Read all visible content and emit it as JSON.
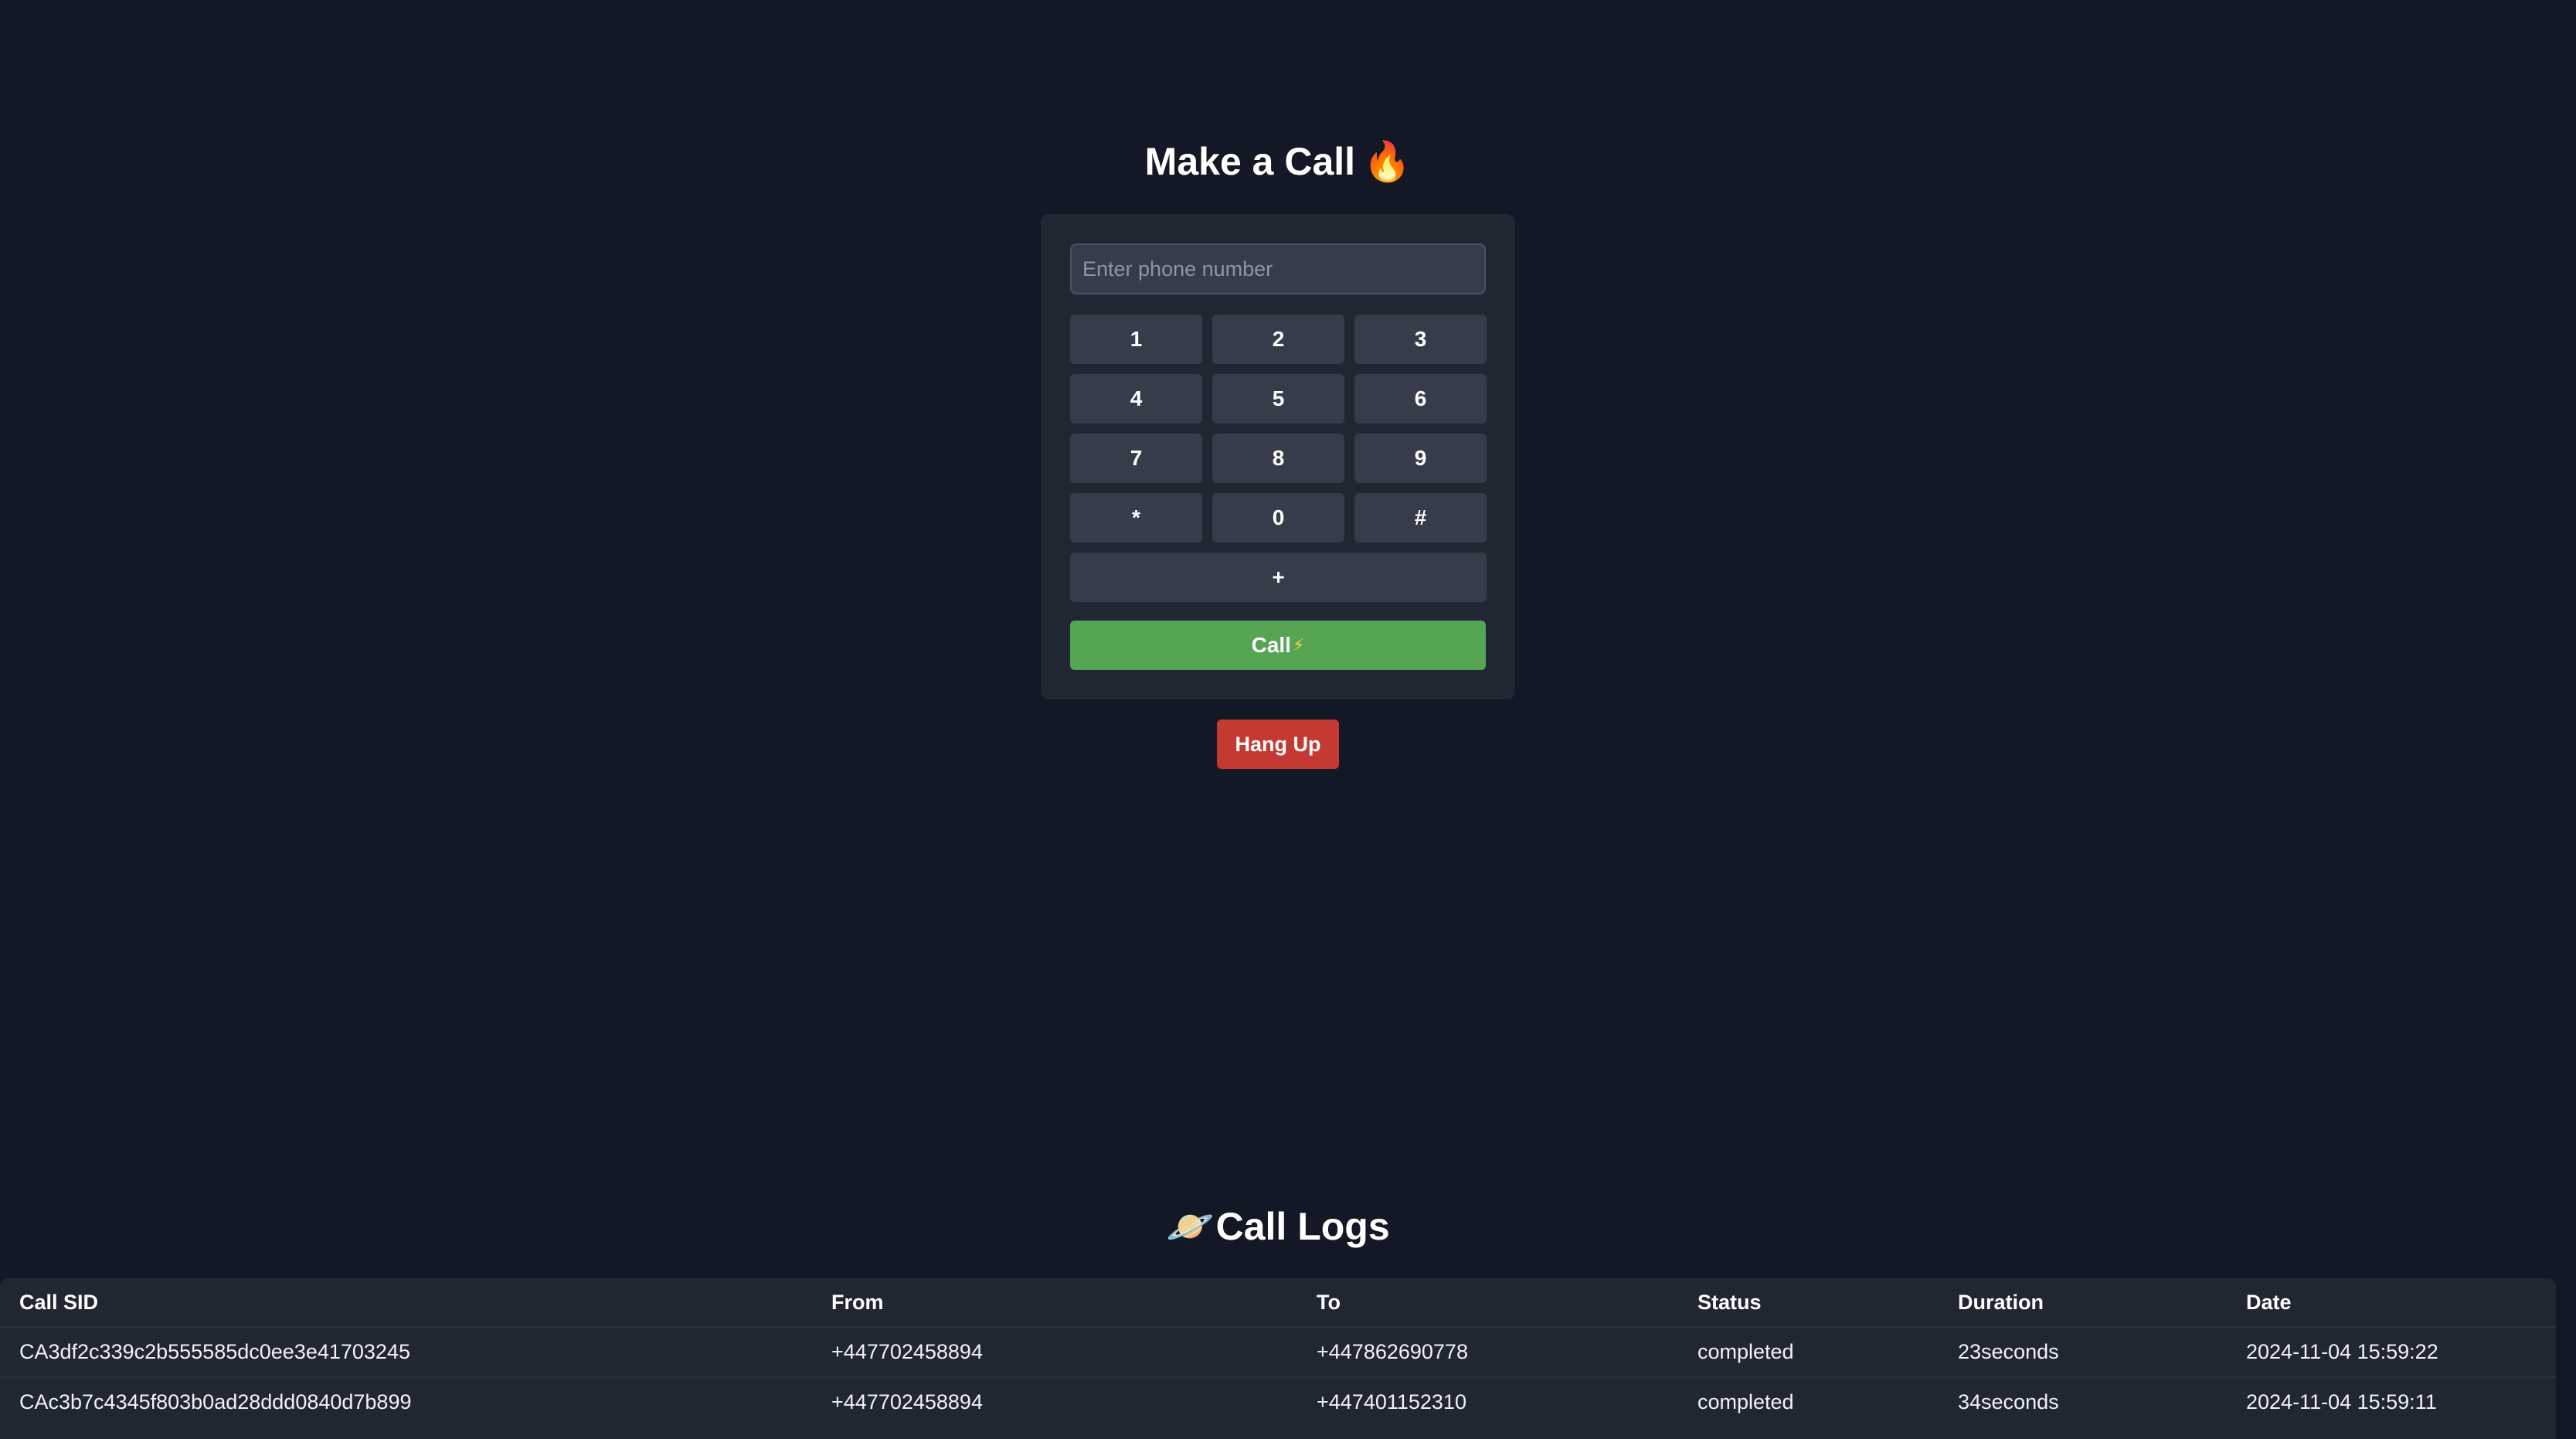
{
  "dialer": {
    "title": "Make a Call",
    "title_emoji": "🔥",
    "input_placeholder": "Enter phone number",
    "input_value": "",
    "keys": [
      "1",
      "2",
      "3",
      "4",
      "5",
      "6",
      "7",
      "8",
      "9",
      "*",
      "0",
      "#"
    ],
    "plus_key": "+",
    "call_label": "Call",
    "call_icon": "⚡",
    "hangup_label": "Hang Up"
  },
  "logs": {
    "title": "Call Logs",
    "title_emoji": "🪐",
    "columns": [
      "Call SID",
      "From",
      "To",
      "Status",
      "Duration",
      "Date"
    ],
    "rows": [
      {
        "sid": "CA3df2c339c2b555585dc0ee3e41703245",
        "from": "+447702458894",
        "to": "+447862690778",
        "status": "completed",
        "duration": "23seconds",
        "date": "2024-11-04 15:59:22"
      },
      {
        "sid": "CAc3b7c4345f803b0ad28ddd0840d7b899",
        "from": "+447702458894",
        "to": "+447401152310",
        "status": "completed",
        "duration": "34seconds",
        "date": "2024-11-04 15:59:11"
      }
    ]
  },
  "colors": {
    "background": "#131826",
    "panel": "#212633",
    "key": "#373c4a",
    "call_button": "#55a555",
    "hangup_button": "#c43a32"
  }
}
